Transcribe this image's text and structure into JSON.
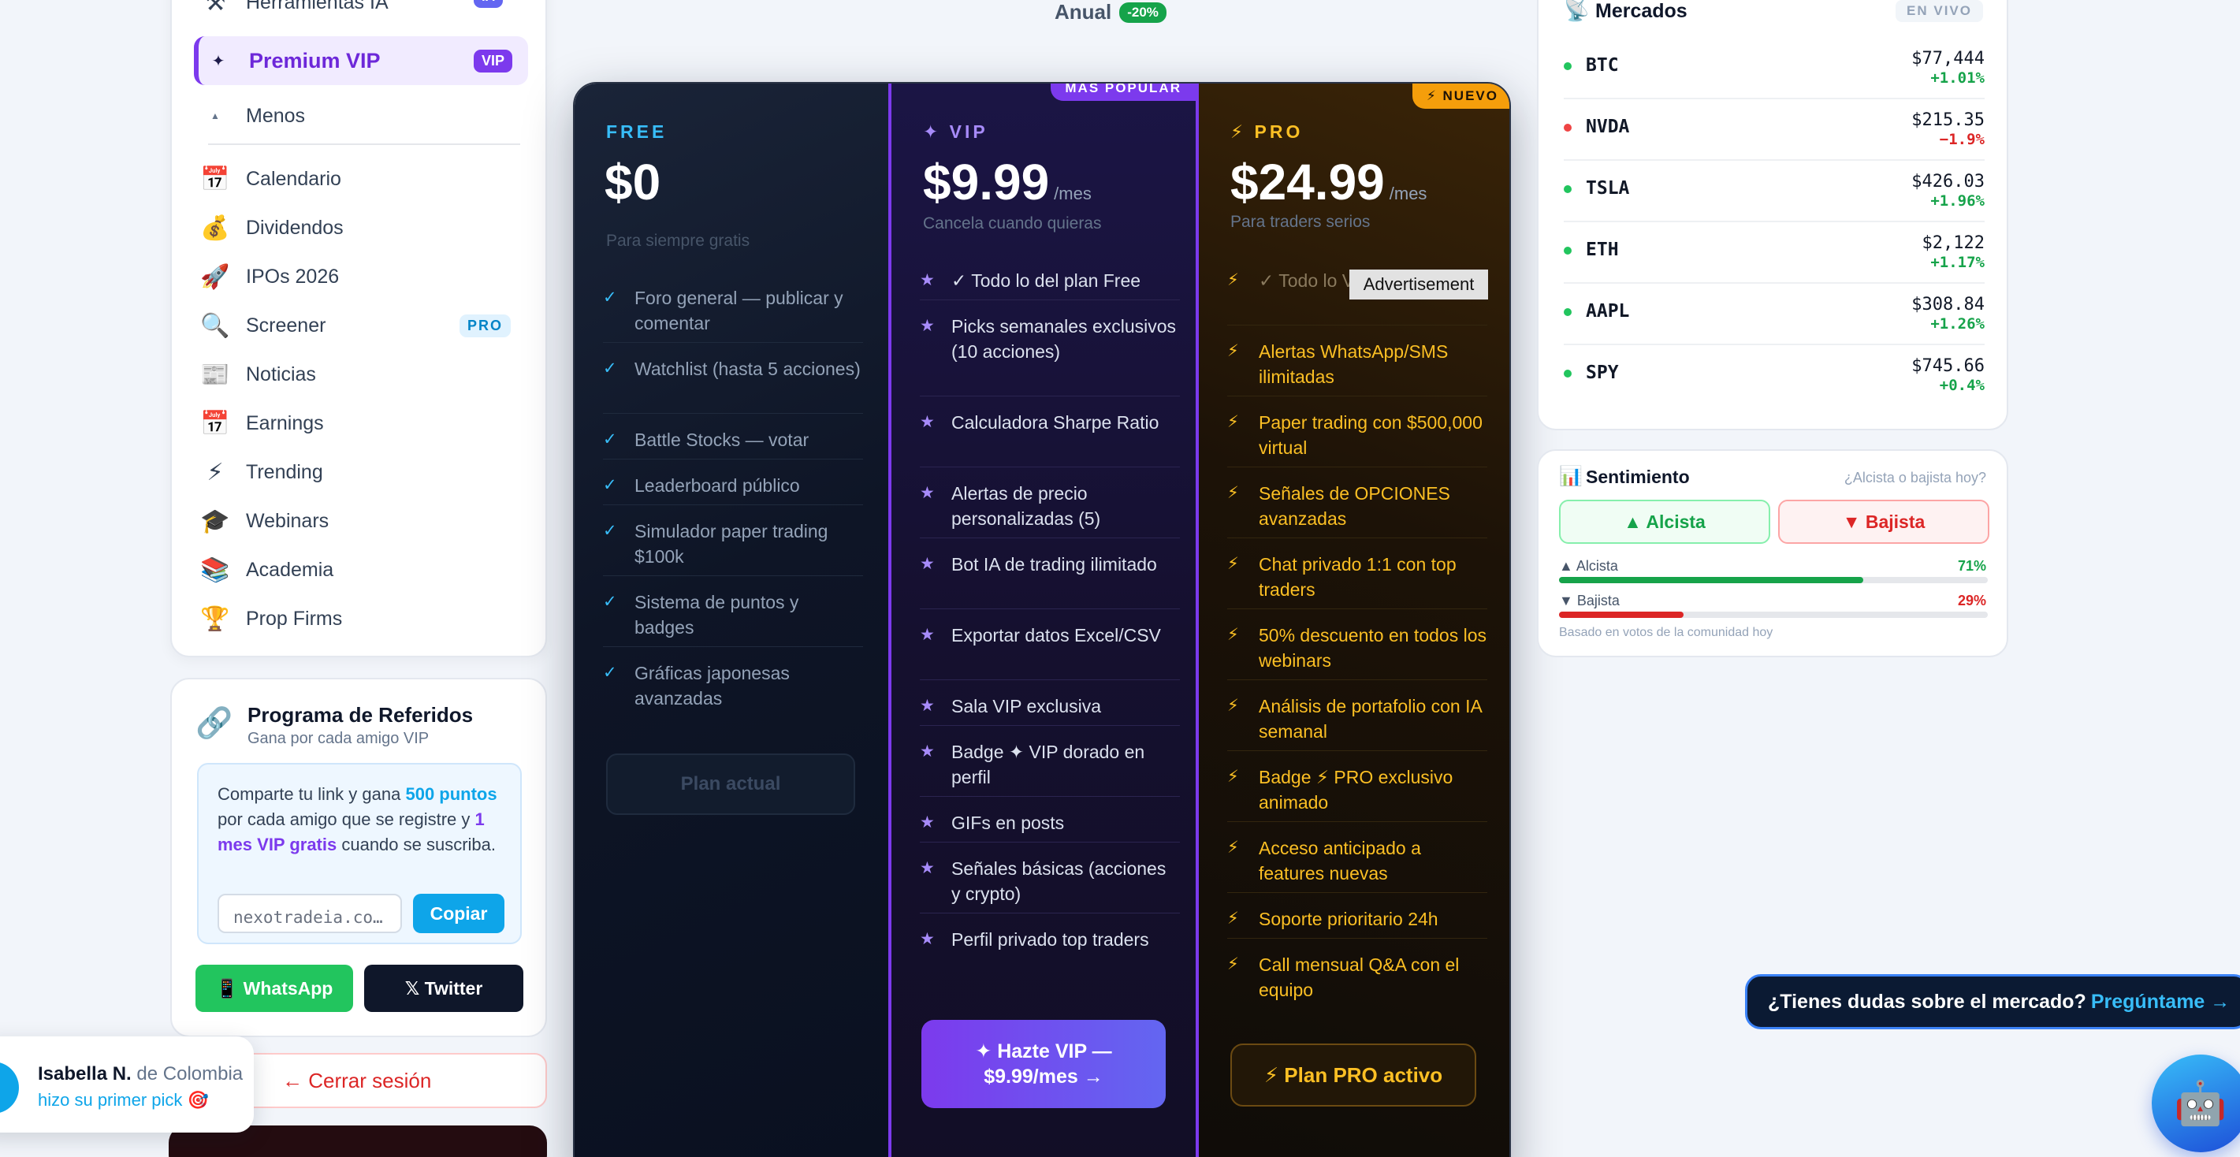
{
  "sidebar": {
    "items_top": [
      {
        "icon": "⚒",
        "label": "Herramientas IA",
        "badge": "IA"
      },
      {
        "icon": "✦",
        "label": "Premium VIP",
        "badge": "VIP"
      },
      {
        "icon": "▲",
        "label": "Menos"
      }
    ],
    "items": [
      {
        "icon": "📅",
        "label": "Calendario"
      },
      {
        "icon": "💰",
        "label": "Dividendos"
      },
      {
        "icon": "🚀",
        "label": "IPOs 2026"
      },
      {
        "icon": "🔍",
        "label": "Screener",
        "badge": "PRO"
      },
      {
        "icon": "📰",
        "label": "Noticias"
      },
      {
        "icon": "📅",
        "label": "Earnings"
      },
      {
        "icon": "⚡",
        "label": "Trending"
      },
      {
        "icon": "🎓",
        "label": "Webinars"
      },
      {
        "icon": "📚",
        "label": "Academia"
      },
      {
        "icon": "🏆",
        "label": "Prop Firms"
      }
    ]
  },
  "referral": {
    "icon": "🔗",
    "title": "Programa de Referidos",
    "subtitle": "Gana por cada amigo VIP",
    "text_1": "Comparte tu link y gana ",
    "points": "500 puntos",
    "text_2": " por cada amigo que se registre y ",
    "vip_free": "1 mes VIP gratis",
    "text_3": " cuando se suscriba.",
    "link_value": "nexotradeia.co…",
    "copy_label": "Copiar",
    "whatsapp_label": "📱 WhatsApp",
    "twitter_label": "𝕏 Twitter"
  },
  "logout_label": "← Cerrar sesión",
  "toast": {
    "name": "Isabella N.",
    "location": " de Colombia",
    "action": "hizo su primer pick 🎯"
  },
  "billing": {
    "label": "Anual",
    "discount": "-20%"
  },
  "plans": {
    "free": {
      "tier": "FREE",
      "price": "$0",
      "subtitle": "Para siempre gratis",
      "features": [
        "Foro general — publicar y comentar",
        "Watchlist (hasta 5 acciones)",
        "Battle Stocks — votar",
        "Leaderboard público",
        "Simulador paper trading $100k",
        "Sistema de puntos y badges",
        "Gráficas japonesas avanzadas"
      ],
      "cta": "Plan actual"
    },
    "vip": {
      "ribbon": "MÁS POPULAR",
      "tier": "✦ VIP",
      "price": "$9.99",
      "per": "/mes",
      "subtitle": "Cancela cuando quieras",
      "features": [
        "✓ Todo lo del plan Free",
        "Picks semanales exclusivos (10 acciones)",
        "Calculadora Sharpe Ratio",
        "Alertas de precio personalizadas (5)",
        "Bot IA de trading ilimitado",
        "Exportar datos Excel/CSV",
        "Sala VIP exclusiva",
        "Badge ✦ VIP dorado en perfil",
        "GIFs en posts",
        "Señales básicas (acciones y crypto)",
        "Perfil privado top traders"
      ],
      "cta": "✦ Hazte VIP — $9.99/mes →"
    },
    "pro": {
      "ribbon": "⚡ NUEVO",
      "tier": "⚡ PRO",
      "price": "$24.99",
      "per": "/mes",
      "subtitle": "Para traders serios",
      "features": [
        "✓ Todo lo VIP incluido",
        "Alertas WhatsApp/SMS ilimitadas",
        "Paper trading con $500,000 virtual",
        "Señales de OPCIONES avanzadas",
        "Chat privado 1:1 con top traders",
        "50% descuento en todos los webinars",
        "Análisis de portafolio con IA semanal",
        "Badge ⚡ PRO exclusivo animado",
        "Acceso anticipado a features nuevas",
        "Soporte prioritario 24h",
        "Call mensual Q&A con el equipo"
      ],
      "cta": "⚡ Plan PRO activo"
    }
  },
  "tooltip": "Advertisement",
  "markets": {
    "title": "Mercados",
    "live": "EN VIVO",
    "rows": [
      {
        "symbol": "BTC",
        "price": "$77,444",
        "change": "+1.01%",
        "up": true
      },
      {
        "symbol": "NVDA",
        "price": "$215.35",
        "change": "−1.9%",
        "up": false
      },
      {
        "symbol": "TSLA",
        "price": "$426.03",
        "change": "+1.96%",
        "up": true
      },
      {
        "symbol": "ETH",
        "price": "$2,122",
        "change": "+1.17%",
        "up": true
      },
      {
        "symbol": "AAPL",
        "price": "$308.84",
        "change": "+1.26%",
        "up": true
      },
      {
        "symbol": "SPY",
        "price": "$745.66",
        "change": "+0.4%",
        "up": true
      }
    ]
  },
  "sentiment": {
    "title": "Sentimiento",
    "question": "¿Alcista o bajista hoy?",
    "bull_button": "▲ Alcista",
    "bear_button": "▼ Bajista",
    "bull_label": "▲ Alcista",
    "bull_pct": "71%",
    "bull_fraction": 0.71,
    "bear_label": "▼ Bajista",
    "bear_pct": "29%",
    "bear_fraction": 0.29,
    "footnote": "Basado en votos de la comunidad hoy"
  },
  "chat": {
    "question": "¿Tienes dudas sobre el mercado? ",
    "link": "Pregúntame →"
  },
  "colors": {
    "vip_accent": "#7c3aed",
    "pro_accent": "#f59e0b",
    "bull": "#16a34a",
    "bear": "#dc2626"
  }
}
